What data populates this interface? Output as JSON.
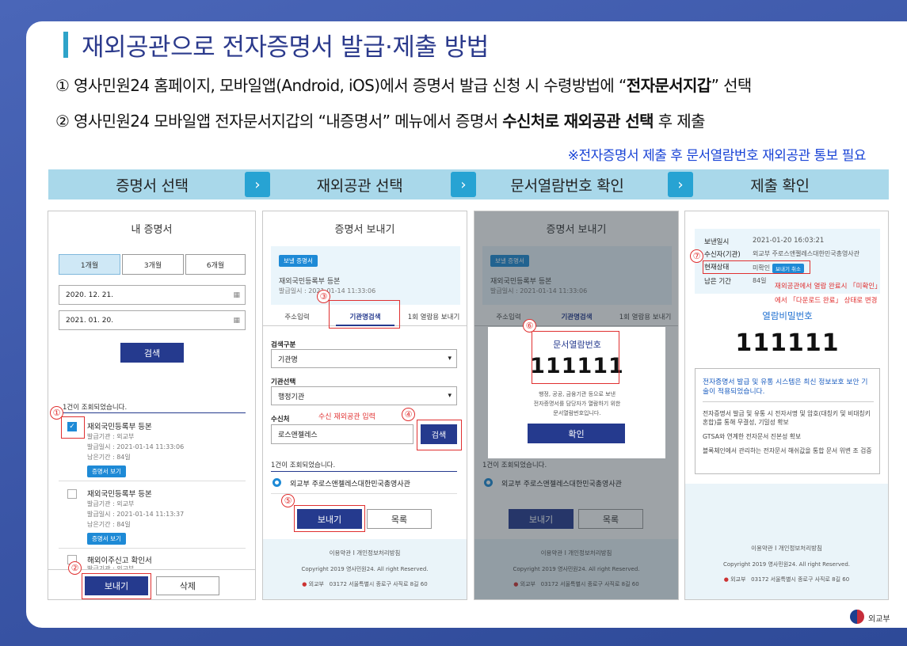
{
  "title": "재외공관으로 전자증명서 발급·제출 방법",
  "line1": {
    "pre": "① 영사민원24 홈페이지, 모바일앱(Android, iOS)에서 증명서 발급 신청 시 수령방법에 “",
    "bold": "전자문서지갑",
    "post": "” 선택"
  },
  "line2": {
    "pre": "② 영사민원24 모바일앱 전자문서지갑의 “내증명서” 메뉴에서 증명서 ",
    "bold": "수신처로 재외공관 선택",
    "post": " 후 제출"
  },
  "note": "※전자증명서 제출 후 문서열람번호 재외공관 통보 필요",
  "steps": [
    "증명서 선택",
    "재외공관 선택",
    "문서열람번호 확인",
    "제출 확인"
  ],
  "arrow": "›",
  "p1": {
    "title": "내 증명서",
    "periods": [
      "1개월",
      "3개월",
      "6개월"
    ],
    "date_from": "2020. 12. 21.",
    "date_to": "2021. 01. 20.",
    "search": "검색",
    "result": "1건이 조회되었습니다.",
    "items": [
      {
        "name": "재외국민등록부 등본",
        "org": "발급기관 : 외교부",
        "date": "발급일시 : 2021-01-14 11:33:06",
        "remain": "남은기간 : 84일",
        "btn": "증명서 보기"
      },
      {
        "name": "재외국민등록부 등본",
        "org": "발급기관 : 외교부",
        "date": "발급일시 : 2021-01-14 11:13:37",
        "remain": "남은기간 : 84일",
        "btn": "증명서 보기"
      },
      {
        "name": "해외이주신고 확인서",
        "org": "발급기관 : 외교부"
      }
    ],
    "send": "보내기",
    "delete": "삭제",
    "n1": "①",
    "n2": "②"
  },
  "p2": {
    "title": "증명서 보내기",
    "tag": "보낼 증명서",
    "doc": "재외국민등록부 등본",
    "date": "발급일시 : 2021-01-14 11:33:06",
    "tabs": [
      "주소입력",
      "기관명검색",
      "1회 열람용 보내기"
    ],
    "l1": "검색구분",
    "s1": "기관명",
    "l2": "기관선택",
    "s2": "행정기관",
    "l3": "수신처",
    "hint": "수신 재외공관 입력",
    "input": "로스앤젤레스",
    "search": "검색",
    "result": "1건이 조회되었습니다.",
    "option": "외교부 주로스앤젤레스대한민국총영사관",
    "send": "보내기",
    "list": "목록",
    "n3": "③",
    "n4": "④",
    "n5": "⑤"
  },
  "p3": {
    "title": "증명서 보내기",
    "tag": "보낼 증명서",
    "doc": "재외국민등록부 등본",
    "date": "발급일시 : 2021-01-14 11:33:06",
    "tabs": [
      "주소입력",
      "기관명검색",
      "1회 열람용 보내기"
    ],
    "result": "1건이 조회되었습니다.",
    "option": "외교부 주로스앤젤레스대한민국총영사관",
    "send": "보내기",
    "list": "목록",
    "modal_title": "문서열람번호",
    "code": "111111",
    "desc1": "행정, 공공, 금융기관 등으로 보낸",
    "desc2": "전자증명서를 담당자가 열람하기 위한",
    "desc3": "문서열람번호입니다.",
    "ok": "확인",
    "n6": "⑥"
  },
  "p4": {
    "r1k": "보낸일시",
    "r1v": "2021-01-20 16:03:21",
    "r2k": "수신자(기관)",
    "r2v": "외교부 주로스앤젤레스대한민국총영사관",
    "r3k": "현재상태",
    "r3v": "미확인",
    "r3btn": "보내기 취소",
    "r4k": "남은 기간",
    "r4v": "84일",
    "red1": "재외공관에서 열람 완료시 「미확인」",
    "red2": "에서 「다운로드 완료」 상태로 변경",
    "pw_label": "열람비밀번호",
    "code": "111111",
    "sec_title": "전자증명서 발급 및 유통 시스템은 최신 정보보호 보안 기술이 적용되었습니다.",
    "sec1": "전자증명서 발급 및 유통 시 전자서명 및 암호(대칭키 및 비대칭키 혼합)를 통해 무결성, 기밀성 확보",
    "sec2": "GTSA와 연계한 전자문서 진본성 확보",
    "sec3": "블록체인에서 관리하는 전자문서 해쉬값을 통합 문서 위변 조 검증",
    "n7": "⑦"
  },
  "footer": {
    "links": "이용약관 I 개인정보처리방침",
    "copy": "Copyright 2019 영사민원24. All right Reserved.",
    "org": "외교부",
    "addr": "03172 서울특별시 종로구 사직로 8길 60"
  },
  "logo": "외교부",
  "colors": {
    "accent": "#253a8e",
    "step_bg": "#a9d8ea",
    "arrow_bg": "#27a3d3",
    "red": "#e03030",
    "title": "#2b3a8c"
  }
}
